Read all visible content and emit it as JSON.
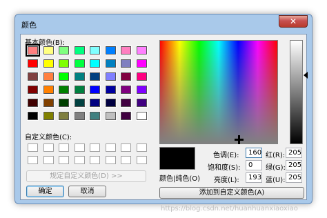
{
  "dialog": {
    "title": "颜色",
    "close_glyph": "✕"
  },
  "basic_colors": {
    "label": "基本颜色(B):",
    "rows": [
      [
        "#ff8080",
        "#ffff80",
        "#80ff80",
        "#00ff80",
        "#80ffff",
        "#0080ff",
        "#ff80c0",
        "#ff80ff"
      ],
      [
        "#ff0000",
        "#ffff00",
        "#80ff00",
        "#00ff40",
        "#00ffff",
        "#0080c0",
        "#8080c0",
        "#ff00ff"
      ],
      [
        "#804040",
        "#ff8040",
        "#00ff00",
        "#008080",
        "#004080",
        "#8080ff",
        "#800040",
        "#ff0080"
      ],
      [
        "#800000",
        "#ff8000",
        "#008000",
        "#008040",
        "#0000ff",
        "#0000a0",
        "#800080",
        "#8000ff"
      ],
      [
        "#400000",
        "#804000",
        "#004000",
        "#004040",
        "#000080",
        "#000040",
        "#400040",
        "#400080"
      ],
      [
        "#000000",
        "#808000",
        "#808040",
        "#808080",
        "#408080",
        "#c0c0c0",
        "#400040",
        "#ffffff"
      ]
    ]
  },
  "custom_colors": {
    "label": "自定义颜色(C):"
  },
  "buttons": {
    "define_custom": "规定自定义颜色(D) >>",
    "ok": "确定",
    "cancel": "取消",
    "add_custom": "添加到自定义颜色(A)"
  },
  "preview_label": "颜色|纯色(O)",
  "fields": {
    "hue_label": "色调(E):",
    "hue_value": "160",
    "sat_label": "饱和度(S):",
    "sat_value": "0",
    "lum_label": "亮度(L):",
    "lum_value": "193",
    "red_label": "红(R):",
    "red_value": "205",
    "green_label": "绿(G):",
    "green_value": "205",
    "blue_label": "蓝(U):",
    "blue_value": "205"
  },
  "watermark": "https://blog.csdn.net/huanhuanxiaoxiao"
}
